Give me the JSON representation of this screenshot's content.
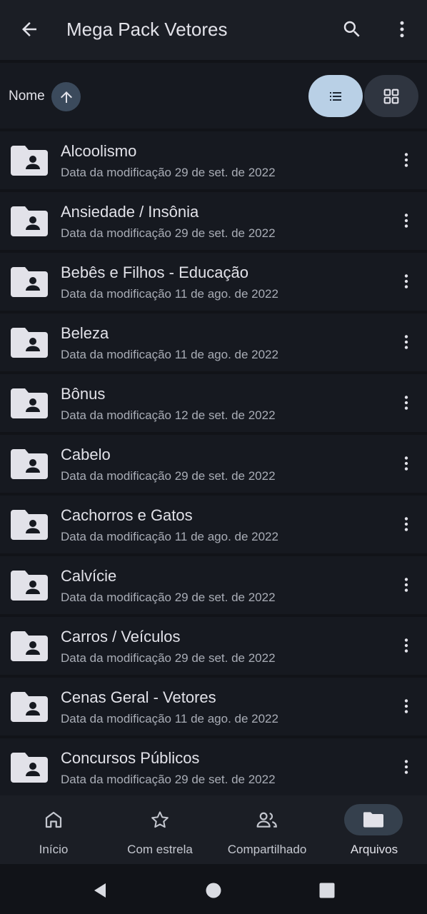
{
  "topbar": {
    "title": "Mega Pack Vetores",
    "back_icon": "arrow-left-icon",
    "search_icon": "search-icon",
    "more_icon": "more-vert-icon"
  },
  "sort": {
    "label": "Nome",
    "direction_icon": "arrow-up-icon"
  },
  "view": {
    "list_icon": "list-view-icon",
    "grid_icon": "grid-view-icon",
    "active": "list"
  },
  "files": [
    {
      "name": "Alcoolismo",
      "meta": "Data da modificação 29 de set. de 2022"
    },
    {
      "name": "Ansiedade / Insônia",
      "meta": "Data da modificação 29 de set. de 2022"
    },
    {
      "name": "Bebês e Filhos - Educação",
      "meta": "Data da modificação 11 de ago. de 2022"
    },
    {
      "name": "Beleza",
      "meta": "Data da modificação 11 de ago. de 2022"
    },
    {
      "name": "Bônus",
      "meta": "Data da modificação 12 de set. de 2022"
    },
    {
      "name": "Cabelo",
      "meta": "Data da modificação 29 de set. de 2022"
    },
    {
      "name": "Cachorros e Gatos",
      "meta": "Data da modificação 11 de ago. de 2022"
    },
    {
      "name": "Calvície",
      "meta": "Data da modificação 29 de set. de 2022"
    },
    {
      "name": "Carros / Veículos",
      "meta": "Data da modificação 29 de set. de 2022"
    },
    {
      "name": "Cenas Geral - Vetores",
      "meta": "Data da modificação 11 de ago. de 2022"
    },
    {
      "name": "Concursos Públicos",
      "meta": "Data da modificação 29 de set. de 2022"
    }
  ],
  "bottomnav": {
    "items": [
      {
        "label": "Início",
        "icon": "home-icon"
      },
      {
        "label": "Com estrela",
        "icon": "star-icon"
      },
      {
        "label": "Compartilhado",
        "icon": "shared-people-icon"
      },
      {
        "label": "Arquivos",
        "icon": "folder-icon"
      }
    ],
    "active": "Arquivos"
  },
  "colors": {
    "background": "#111318",
    "bar": "#1b1e25",
    "accent": "#b9d0e6",
    "icon": "#e2e2e9"
  }
}
